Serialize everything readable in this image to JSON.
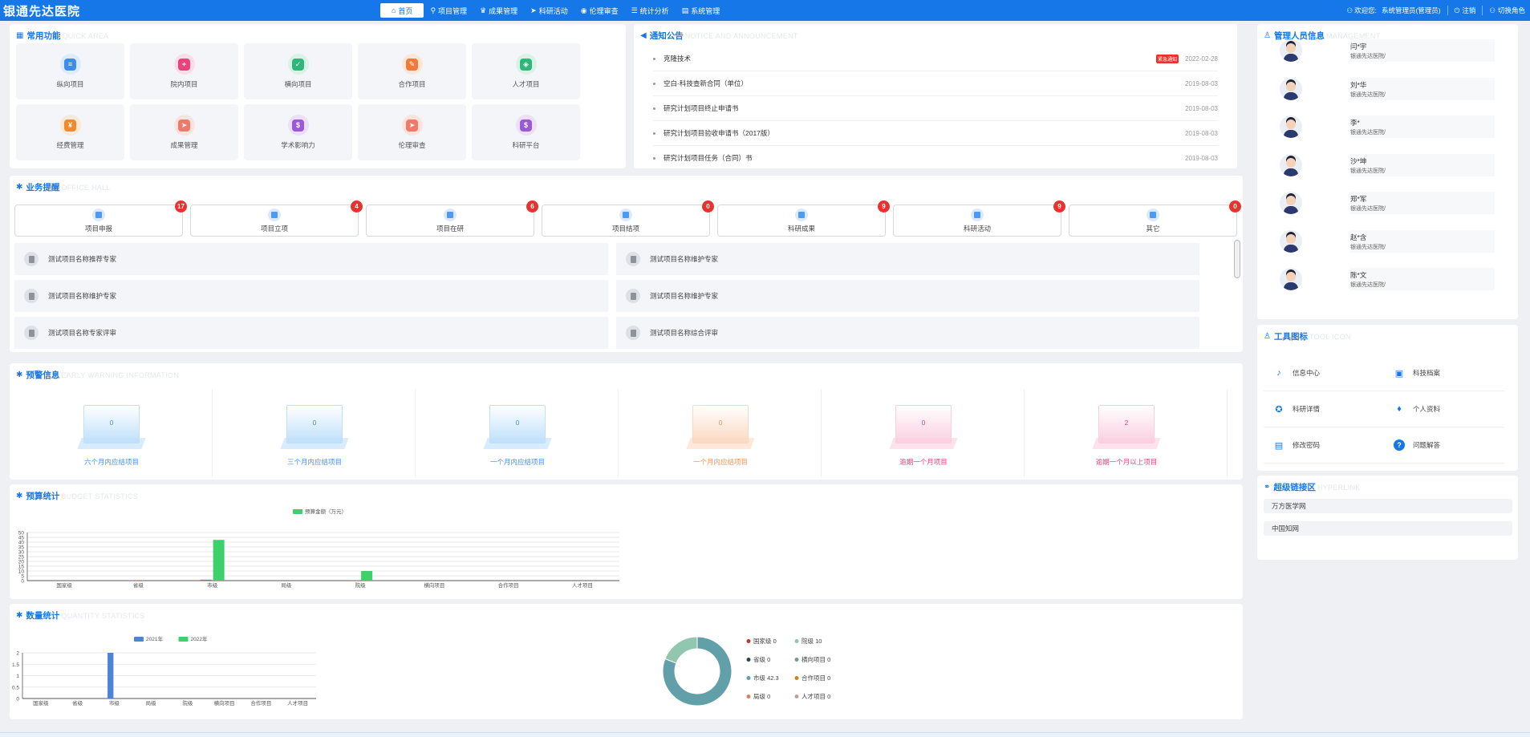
{
  "header": {
    "logo": "银通先达医院",
    "nav": [
      {
        "label": "首页",
        "icon": "home-icon",
        "active": true
      },
      {
        "label": "项目管理",
        "icon": "sitemap-icon"
      },
      {
        "label": "成果管理",
        "icon": "trophy-icon"
      },
      {
        "label": "科研活动",
        "icon": "send-icon"
      },
      {
        "label": "伦理审查",
        "icon": "globe-icon"
      },
      {
        "label": "统计分析",
        "icon": "database-icon"
      },
      {
        "label": "系统管理",
        "icon": "book-icon"
      }
    ],
    "welcome": "欢迎您:",
    "user": "系统管理员(管理员)",
    "logout": "注销",
    "switch_role": "切换角色"
  },
  "quick": {
    "title": "常用功能",
    "title_en": "QUICK AREA",
    "items": [
      {
        "label": "纵向项目",
        "icon": "doc-icon",
        "color": "#3a8ee6",
        "bg": "#dcebfb"
      },
      {
        "label": "院内项目",
        "icon": "doc-plus-icon",
        "color": "#e8437a",
        "bg": "#fbdde8"
      },
      {
        "label": "横向项目",
        "icon": "check-icon",
        "color": "#2fb67a",
        "bg": "#d8f3e6"
      },
      {
        "label": "合作项目",
        "icon": "wrench-icon",
        "color": "#f07a3a",
        "bg": "#fde5d8"
      },
      {
        "label": "人才项目",
        "icon": "layers-icon",
        "color": "#2fb67a",
        "bg": "#d8f3e6"
      },
      {
        "label": "经费管理",
        "icon": "money-icon",
        "color": "#f08a2a",
        "bg": "#fde8d4"
      },
      {
        "label": "成果管理",
        "icon": "plane-icon",
        "color": "#f07a6a",
        "bg": "#fde3df"
      },
      {
        "label": "学术影响力",
        "icon": "bag-icon",
        "color": "#9b59d6",
        "bg": "#ece0f8"
      },
      {
        "label": "伦理审查",
        "icon": "plane-icon",
        "color": "#f07a6a",
        "bg": "#fde3df"
      },
      {
        "label": "科研平台",
        "icon": "bag-icon",
        "color": "#9b59d6",
        "bg": "#ece0f8"
      }
    ]
  },
  "notice": {
    "title": "通知公告",
    "title_en": "NOTICE AND ANNOUNCEMENT",
    "items": [
      {
        "title": "克隆技术",
        "badge": "紧急通知",
        "date": "2022-02-28"
      },
      {
        "title": "空白-科技查新合同（单位）",
        "badge": "",
        "date": "2019-08-03"
      },
      {
        "title": "研究计划项目终止申请书",
        "badge": "",
        "date": "2019-08-03"
      },
      {
        "title": "研究计划项目验收申请书（2017版）",
        "badge": "",
        "date": "2019-08-03"
      },
      {
        "title": "研究计划项目任务（合同）书",
        "badge": "",
        "date": "2019-08-03"
      }
    ]
  },
  "business": {
    "title": "业务提醒",
    "title_en": "OFFICE HALL",
    "tabs": [
      {
        "label": "项目申报",
        "count": "17"
      },
      {
        "label": "项目立项",
        "count": "4"
      },
      {
        "label": "项目在研",
        "count": "6"
      },
      {
        "label": "项目结项",
        "count": "0"
      },
      {
        "label": "科研成果",
        "count": "9"
      },
      {
        "label": "科研活动",
        "count": "9"
      },
      {
        "label": "其它",
        "count": "0"
      }
    ],
    "tasks": [
      "测试项目名称推荐专家",
      "测试项目名称维护专家",
      "测试项目名称维护专家",
      "测试项目名称维护专家",
      "测试项目名称专家评审",
      "测试项目名称综合评审"
    ]
  },
  "warning": {
    "title": "预警信息",
    "title_en": "EARLY WARNING INFORMATION",
    "items": [
      {
        "value": "0",
        "label": "六个月内应结项目",
        "color": "#4a90e2",
        "fill": "#bfe0fb"
      },
      {
        "value": "0",
        "label": "三个月内应结项目",
        "color": "#4a90e2",
        "fill": "#bfe0fb"
      },
      {
        "value": "0",
        "label": "一个月内应结项目",
        "color": "#4a90e2",
        "fill": "#bfe0fb"
      },
      {
        "value": "0",
        "label": "一个月内应结项目",
        "color": "#f0925a",
        "fill": "#fbd9c1"
      },
      {
        "value": "0",
        "label": "逾期一个月项目",
        "color": "#e8437a",
        "fill": "#fbcfe0"
      },
      {
        "value": "2",
        "label": "逾期一个月以上项目",
        "color": "#e8437a",
        "fill": "#fbcfe0"
      }
    ]
  },
  "budget": {
    "title": "预算统计",
    "title_en": "BUDGET STATISTICS"
  },
  "quantity": {
    "title": "数量统计",
    "title_en": "QUANTITY STATISTICS",
    "pie_legend": [
      {
        "name": "国家级",
        "value": "0",
        "color": "#c23531"
      },
      {
        "name": "院级",
        "value": "10",
        "color": "#91c7ae"
      },
      {
        "name": "省级",
        "value": "0",
        "color": "#2f4554"
      },
      {
        "name": "横向项目",
        "value": "0",
        "color": "#749f83"
      },
      {
        "name": "市级",
        "value": "42.3",
        "color": "#61a0a8"
      },
      {
        "name": "合作项目",
        "value": "0",
        "color": "#ca8622"
      },
      {
        "name": "局级",
        "value": "0",
        "color": "#d48265"
      },
      {
        "name": "人才项目",
        "value": "0",
        "color": "#bda29a"
      }
    ]
  },
  "chart_data": [
    {
      "type": "bar",
      "title": "",
      "categories": [
        "国家级",
        "省级",
        "市级",
        "局级",
        "院级",
        "横向项目",
        "合作项目",
        "人才项目"
      ],
      "series": [
        {
          "name": "",
          "color": "#4a85d8",
          "values": [
            0,
            0.5,
            1,
            0,
            0.5,
            0,
            0,
            0
          ]
        },
        {
          "name": "预算金额（万元）",
          "color": "#3ed06a",
          "values": [
            0,
            0,
            42.3,
            0,
            10,
            0,
            0,
            0
          ]
        }
      ],
      "legend": [
        "预算金额（万元）"
      ],
      "y_ticks": [
        "0",
        "5",
        "10",
        "15",
        "20",
        "25",
        "30",
        "35",
        "40",
        "45",
        "50"
      ],
      "ylim": [
        0,
        50
      ]
    },
    {
      "type": "bar",
      "title": "",
      "categories": [
        "国家级",
        "省级",
        "市级",
        "局级",
        "院级",
        "横向项目",
        "合作项目",
        "人才项目"
      ],
      "series": [
        {
          "name": "2021年",
          "color": "#4a85d8",
          "values": [
            0,
            0,
            2,
            0,
            0,
            0,
            0,
            0
          ]
        },
        {
          "name": "2022年",
          "color": "#3ed06a",
          "values": [
            0,
            0,
            0,
            0,
            0,
            0,
            0,
            0
          ]
        }
      ],
      "y_ticks": [
        "0",
        "0.5",
        "1",
        "1.5",
        "2"
      ],
      "ylim": [
        0,
        2
      ]
    },
    {
      "type": "pie",
      "title": "",
      "categories": [
        "国家级",
        "省级",
        "市级",
        "局级",
        "院级",
        "横向项目",
        "合作项目",
        "人才项目"
      ],
      "values": [
        0,
        0,
        42.3,
        0,
        10,
        0,
        0,
        0
      ]
    }
  ],
  "staff": {
    "title": "管理人员信息",
    "title_en": "MANAGEMENT",
    "items": [
      {
        "name": "闫*宇",
        "org": "银通先达医院/"
      },
      {
        "name": "刘*华",
        "org": "银通先达医院/"
      },
      {
        "name": "李*",
        "org": "银通先达医院/"
      },
      {
        "name": "沙*坤",
        "org": "银通先达医院/"
      },
      {
        "name": "郑*军",
        "org": "银通先达医院/"
      },
      {
        "name": "赵*含",
        "org": "银通先达医院/"
      },
      {
        "name": "陈*文",
        "org": "银通先达医院/"
      }
    ]
  },
  "tools": {
    "title": "工具图标",
    "title_en": "TOOL ICON",
    "items": [
      {
        "label": "信息中心",
        "icon": "bell-icon"
      },
      {
        "label": "科技档案",
        "icon": "briefcase-icon"
      },
      {
        "label": "科研详情",
        "icon": "medal-icon"
      },
      {
        "label": "个人资料",
        "icon": "pin-icon"
      },
      {
        "label": "修改密码",
        "icon": "doc-edit-icon"
      },
      {
        "label": "问题解答",
        "icon": "question-icon"
      }
    ]
  },
  "links": {
    "title": "超级链接区",
    "title_en": "HYPERLINK",
    "items": [
      "万方医学网",
      "中国知网"
    ]
  }
}
